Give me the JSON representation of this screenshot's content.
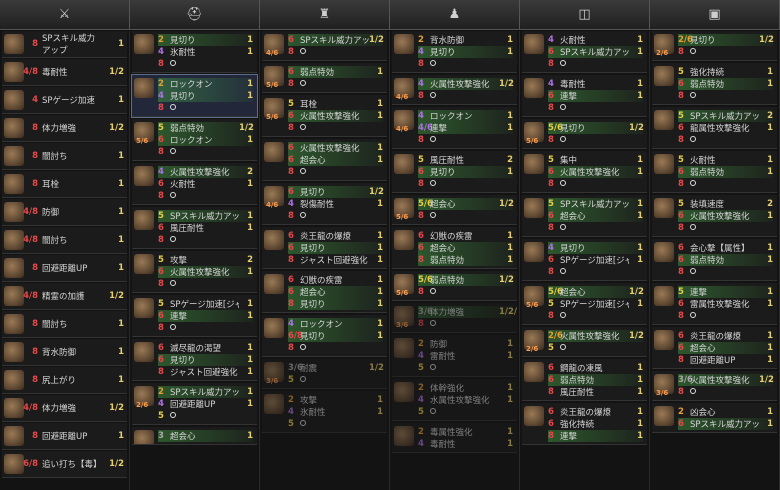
{
  "header": [
    "⚔",
    "⛑",
    "♜",
    "♟",
    "◫",
    "▣"
  ],
  "col1": [
    {
      "num": "8",
      "text": "SPスキル威力アップ",
      "val": "1"
    },
    {
      "num": "4/8",
      "text": "毒耐性",
      "val": "1/2"
    },
    {
      "num": "4",
      "text": "SPゲージ加速",
      "val": "1"
    },
    {
      "num": "8",
      "text": "体力増強",
      "val": "1/2"
    },
    {
      "num": "8",
      "text": "闇討ち",
      "val": "1"
    },
    {
      "num": "8",
      "text": "耳栓",
      "val": "1"
    },
    {
      "num": "4/8",
      "text": "防御",
      "val": "1"
    },
    {
      "num": "4/8",
      "text": "闇討ち",
      "val": "1"
    },
    {
      "num": "8",
      "text": "回避距離UP",
      "val": "1"
    },
    {
      "num": "4/8",
      "text": "精霊の加護",
      "val": "1/2"
    },
    {
      "num": "8",
      "text": "闇討ち",
      "val": "1"
    },
    {
      "num": "8",
      "text": "背水防御",
      "val": "1"
    },
    {
      "num": "8",
      "text": "尻上がり",
      "val": "1"
    },
    {
      "num": "4/8",
      "text": "体力増強",
      "val": "1/2"
    },
    {
      "num": "8",
      "text": "回避距離UP",
      "val": "1"
    },
    {
      "num": "6/8",
      "text": "追い打ち【毒】",
      "val": "1/2"
    }
  ],
  "col2": [
    {
      "lvl": "",
      "rows": [
        [
          "2",
          "見切り",
          "1"
        ],
        [
          "4",
          "氷耐性",
          "1"
        ],
        [
          "8",
          "○",
          ""
        ]
      ]
    },
    {
      "lvl": "",
      "sel": true,
      "rows": [
        [
          "2",
          "ロックオン",
          "1"
        ],
        [
          "4",
          "見切り",
          "1"
        ],
        [
          "8",
          "○",
          ""
        ]
      ]
    },
    {
      "lvl": "5/6",
      "rows": [
        [
          "5",
          "弱点特効",
          "1/2"
        ],
        [
          "6",
          "ロックオン",
          "1"
        ],
        [
          "8",
          "○",
          ""
        ]
      ]
    },
    {
      "lvl": "",
      "rows": [
        [
          "4",
          "火属性攻撃強化",
          "2"
        ],
        [
          "6",
          "火耐性",
          "1"
        ],
        [
          "8",
          "○",
          ""
        ]
      ]
    },
    {
      "lvl": "",
      "rows": [
        [
          "5",
          "SPスキル威力アップ",
          "1"
        ],
        [
          "6",
          "風圧耐性",
          "1"
        ],
        [
          "8",
          "○",
          ""
        ]
      ]
    },
    {
      "lvl": "",
      "rows": [
        [
          "5",
          "攻撃",
          "2"
        ],
        [
          "6",
          "火属性攻撃強化",
          "1"
        ],
        [
          "8",
          "○",
          ""
        ]
      ]
    },
    {
      "lvl": "",
      "rows": [
        [
          "5",
          "SPゲージ加速[ジャスト回避]",
          "1"
        ],
        [
          "6",
          "連撃",
          "1"
        ],
        [
          "8",
          "○",
          ""
        ]
      ]
    },
    {
      "lvl": "",
      "rows": [
        [
          "6",
          "滅尽龍の渇望",
          "1"
        ],
        [
          "6",
          "見切り",
          "1"
        ],
        [
          "8",
          "ジャスト回避強化",
          "1"
        ]
      ]
    },
    {
      "lvl": "2/6",
      "rows": [
        [
          "2",
          "SPスキル威力アップ",
          "1"
        ],
        [
          "4",
          "回避距離UP",
          "1"
        ],
        [
          "5",
          "○",
          ""
        ]
      ]
    },
    {
      "lvl": "3/6",
      "rows": [
        [
          "3",
          "超会心",
          "1"
        ]
      ]
    }
  ],
  "col3": [
    {
      "lvl": "4/6",
      "rows": [
        [
          "6",
          "SPスキル威力アップ",
          "1/2"
        ],
        [
          "8",
          "○",
          ""
        ]
      ]
    },
    {
      "lvl": "5/6",
      "rows": [
        [
          "6",
          "弱点特効",
          "1"
        ],
        [
          "8",
          "○",
          ""
        ]
      ]
    },
    {
      "lvl": "5/6",
      "rows": [
        [
          "5",
          "耳栓",
          "1"
        ],
        [
          "6",
          "火属性攻撃強化",
          "1"
        ],
        [
          "8",
          "○",
          ""
        ]
      ]
    },
    {
      "lvl": "",
      "rows": [
        [
          "6",
          "火属性攻撃強化",
          "1"
        ],
        [
          "6",
          "超会心",
          "1"
        ],
        [
          "8",
          "○",
          ""
        ]
      ]
    },
    {
      "lvl": "4/6",
      "rows": [
        [
          "6",
          "見切り",
          "1/2"
        ],
        [
          "4",
          "裂傷耐性",
          "1"
        ],
        [
          "8",
          "○",
          ""
        ]
      ]
    },
    {
      "lvl": "",
      "rows": [
        [
          "6",
          "炎王龍の爆燎",
          "1"
        ],
        [
          "6",
          "見切り",
          "1"
        ],
        [
          "8",
          "ジャスト回避強化",
          "1"
        ]
      ]
    },
    {
      "lvl": "",
      "rows": [
        [
          "6",
          "幻獣の疾雷",
          "1"
        ],
        [
          "6",
          "超会心",
          "1"
        ],
        [
          "8",
          "見切り",
          "1"
        ]
      ]
    },
    {
      "lvl": "",
      "rows": [
        [
          "4",
          "ロックオン",
          "1"
        ],
        [
          "6/8",
          "見切り",
          "1"
        ],
        [
          "8",
          "○",
          ""
        ]
      ]
    },
    {
      "lvl": "3/6",
      "dim": true,
      "rows": [
        [
          "3/6",
          "耐震",
          "1/2"
        ],
        [
          "5",
          "○",
          ""
        ]
      ]
    },
    {
      "lvl": "",
      "dim": true,
      "rows": [
        [
          "2",
          "攻撃",
          "1"
        ],
        [
          "4",
          "氷耐性",
          "1"
        ],
        [
          "5",
          "○",
          ""
        ]
      ]
    }
  ],
  "col4": [
    {
      "lvl": "",
      "rows": [
        [
          "2",
          "背水防御",
          "1"
        ],
        [
          "4",
          "見切り",
          "1"
        ],
        [
          "8",
          "○",
          ""
        ]
      ]
    },
    {
      "lvl": "4/6",
      "rows": [
        [
          "4",
          "火属性攻撃強化",
          "1/2"
        ],
        [
          "8",
          "○",
          ""
        ]
      ]
    },
    {
      "lvl": "4/6",
      "rows": [
        [
          "4",
          "ロックオン",
          "1"
        ],
        [
          "4/6",
          "連撃",
          "1"
        ],
        [
          "8",
          "○",
          ""
        ]
      ]
    },
    {
      "lvl": "",
      "rows": [
        [
          "5",
          "風圧耐性",
          "2"
        ],
        [
          "6",
          "見切り",
          "1"
        ],
        [
          "8",
          "○",
          ""
        ]
      ]
    },
    {
      "lvl": "5/6",
      "rows": [
        [
          "5/6",
          "超会心",
          "1/2"
        ],
        [
          "8",
          "○",
          ""
        ]
      ]
    },
    {
      "lvl": "",
      "rows": [
        [
          "6",
          "幻獣の疾雷",
          "1"
        ],
        [
          "6",
          "超会心",
          "1"
        ],
        [
          "8",
          "弱点特効",
          "1"
        ]
      ]
    },
    {
      "lvl": "5/6",
      "rows": [
        [
          "5/6",
          "弱点特効",
          "1/2"
        ],
        [
          "8",
          "○",
          ""
        ]
      ]
    },
    {
      "lvl": "3/6",
      "dim": true,
      "rows": [
        [
          "3/6",
          "体力増強",
          "1/2/3"
        ],
        [
          "8",
          "○",
          ""
        ]
      ]
    },
    {
      "lvl": "",
      "dim": true,
      "rows": [
        [
          "2",
          "防御",
          "1"
        ],
        [
          "4",
          "雷耐性",
          "1"
        ],
        [
          "5",
          "○",
          ""
        ]
      ]
    },
    {
      "lvl": "",
      "dim": true,
      "rows": [
        [
          "2",
          "体幹強化",
          "1"
        ],
        [
          "4",
          "水属性攻撃強化",
          "1"
        ],
        [
          "5",
          "○",
          ""
        ]
      ]
    },
    {
      "lvl": "",
      "dim": true,
      "rows": [
        [
          "2",
          "毒属性強化",
          "1"
        ],
        [
          "4",
          "毒耐性",
          "1"
        ]
      ]
    }
  ],
  "col5": [
    {
      "lvl": "",
      "rows": [
        [
          "4",
          "火耐性",
          "1"
        ],
        [
          "6",
          "SPスキル威力アップ",
          "1"
        ],
        [
          "8",
          "○",
          ""
        ]
      ]
    },
    {
      "lvl": "",
      "rows": [
        [
          "4",
          "毒耐性",
          "1"
        ],
        [
          "6",
          "連撃",
          "1"
        ],
        [
          "8",
          "○",
          ""
        ]
      ]
    },
    {
      "lvl": "5/6",
      "rows": [
        [
          "5/6",
          "見切り",
          "1/2"
        ],
        [
          "8",
          "○",
          ""
        ]
      ]
    },
    {
      "lvl": "",
      "rows": [
        [
          "5",
          "集中",
          "1"
        ],
        [
          "6",
          "火属性攻撃強化",
          "1"
        ],
        [
          "8",
          "○",
          ""
        ]
      ]
    },
    {
      "lvl": "",
      "rows": [
        [
          "5",
          "SPスキル威力アップ",
          "1"
        ],
        [
          "6",
          "超会心",
          "1"
        ],
        [
          "8",
          "○",
          ""
        ]
      ]
    },
    {
      "lvl": "",
      "rows": [
        [
          "4",
          "見切り",
          "1"
        ],
        [
          "6",
          "SPゲージ加速[ジャスト回避]",
          "1"
        ],
        [
          "8",
          "○",
          ""
        ]
      ]
    },
    {
      "lvl": "5/6",
      "rows": [
        [
          "5/6",
          "超会心",
          "1/2"
        ],
        [
          "5",
          "SPゲージ加速[ジャスト回避]",
          "1"
        ],
        [
          "8",
          "○",
          ""
        ]
      ]
    },
    {
      "lvl": "2/6",
      "rows": [
        [
          "2/6",
          "火属性攻撃強化",
          "1/2"
        ],
        [
          "5",
          "○",
          ""
        ]
      ]
    },
    {
      "lvl": "",
      "rows": [
        [
          "6",
          "鋼龍の凍風",
          "1"
        ],
        [
          "6",
          "弱点特効",
          "1"
        ],
        [
          "8",
          "風圧耐性",
          "1"
        ]
      ]
    },
    {
      "lvl": "",
      "rows": [
        [
          "6",
          "炎王龍の爆燎",
          "1"
        ],
        [
          "6",
          "強化持続",
          "1"
        ],
        [
          "8",
          "連撃",
          "1"
        ]
      ]
    }
  ],
  "col6": [
    {
      "lvl": "2/6",
      "rows": [
        [
          "2/6",
          "見切り",
          "1/2"
        ],
        [
          "8",
          "○",
          ""
        ]
      ]
    },
    {
      "lvl": "",
      "rows": [
        [
          "5",
          "強化持続",
          "1"
        ],
        [
          "6",
          "弱点特効",
          "1"
        ],
        [
          "8",
          "○",
          ""
        ]
      ]
    },
    {
      "lvl": "",
      "rows": [
        [
          "5",
          "SPスキル威力アップ",
          "2"
        ],
        [
          "6",
          "龍属性攻撃強化",
          "1"
        ],
        [
          "8",
          "○",
          ""
        ]
      ]
    },
    {
      "lvl": "",
      "rows": [
        [
          "5",
          "火耐性",
          "1"
        ],
        [
          "6",
          "弱点特効",
          "1"
        ],
        [
          "8",
          "○",
          ""
        ]
      ]
    },
    {
      "lvl": "",
      "rows": [
        [
          "5",
          "装填速度",
          "2"
        ],
        [
          "6",
          "火属性攻撃強化",
          "1"
        ],
        [
          "8",
          "○",
          ""
        ]
      ]
    },
    {
      "lvl": "",
      "rows": [
        [
          "6",
          "会心撃【属性】",
          "1"
        ],
        [
          "6",
          "弱点特効",
          "1"
        ],
        [
          "8",
          "○",
          ""
        ]
      ]
    },
    {
      "lvl": "",
      "rows": [
        [
          "5",
          "連撃",
          "1"
        ],
        [
          "6",
          "雷属性攻撃強化",
          "1"
        ],
        [
          "8",
          "○",
          ""
        ]
      ]
    },
    {
      "lvl": "",
      "rows": [
        [
          "6",
          "炎王龍の爆燎",
          "1"
        ],
        [
          "6",
          "超会心",
          "1"
        ],
        [
          "8",
          "回避距離UP",
          "1"
        ]
      ]
    },
    {
      "lvl": "3/6",
      "rows": [
        [
          "3/6",
          "火属性攻撃強化",
          "1/2"
        ],
        [
          "8",
          "○",
          ""
        ]
      ]
    },
    {
      "lvl": "",
      "rows": [
        [
          "2",
          "凶会心",
          "1"
        ],
        [
          "6",
          "SPスキル威力アップ",
          "1"
        ]
      ]
    }
  ],
  "highlights": [
    "SPスキル威力アップ",
    "見切り",
    "弱点特効",
    "超会心",
    "火属性攻撃強化",
    "連撃",
    "ロックオン",
    "闇討ち",
    "体力増強"
  ]
}
